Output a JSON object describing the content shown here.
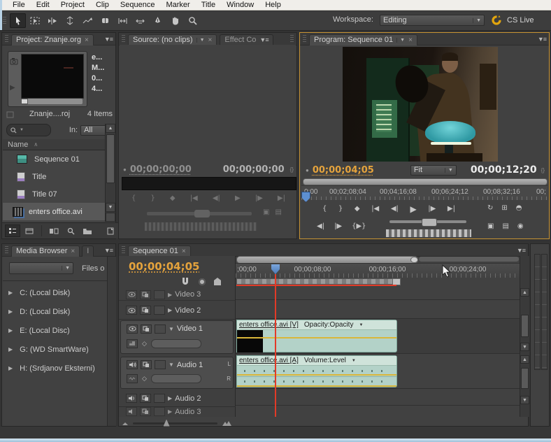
{
  "menu_bar": {
    "items": [
      "File",
      "Edit",
      "Project",
      "Clip",
      "Sequence",
      "Marker",
      "Title",
      "Window",
      "Help"
    ]
  },
  "toolbar": {
    "workspace_label": "Workspace:",
    "workspace_value": "Editing",
    "cs_live_label": "CS Live"
  },
  "icons": {
    "close": "×",
    "dropdown": "▼",
    "panel_menu": "▼≡",
    "collapsed": "▶",
    "expanded": "▼",
    "sort_asc": "∧",
    "scroll_up": "▲",
    "scroll_down": "▼",
    "scroll_left": "◀",
    "scroll_right": "▶",
    "trim_handles": "{}",
    "keyframe": "◇",
    "play": "▶"
  },
  "transport": {
    "row1": [
      "{",
      "}",
      "◆",
      "|◀",
      "◀|",
      "▶",
      "|▶",
      "▶|"
    ],
    "row1_right": [
      "↻",
      "⊞",
      "◓"
    ],
    "row2": [
      "◀|",
      "|▶",
      "{▶}"
    ],
    "row2_right": [
      "▣",
      "▤",
      "◉"
    ]
  },
  "project_panel": {
    "tab_label": "Project: Znanje.org",
    "preview_lines": [
      "e...",
      "M...",
      "0...",
      "4..."
    ],
    "name_truncated": "Znanje....roj",
    "items_count": "4 Items",
    "in_label": "In:",
    "in_value": "All",
    "name_column": "Name",
    "items": [
      {
        "label": "Sequence 01"
      },
      {
        "label": "Title"
      },
      {
        "label": "Title 07"
      },
      {
        "label": "enters office.avi"
      }
    ]
  },
  "source_panel": {
    "tab_label": "Source: (no clips)",
    "effects_tab_label": "Effect Co",
    "tc_left": "00;00;00;00",
    "tc_right": "00;00;00;00"
  },
  "program_panel": {
    "tab_label": "Program: Sequence 01",
    "tc_current": "00;00;04;05",
    "fit_label": "Fit",
    "tc_total": "00;00;12;20",
    "ruler_ticks": [
      "0;00",
      "00;02;08;04",
      "00;04;16;08",
      "00;06;24;12",
      "00;08;32;16",
      "00;"
    ]
  },
  "media_browser": {
    "tab_label": "Media Browser",
    "second_tab_label": "I",
    "files_label": "Files o",
    "drives": [
      "C: (Local Disk)",
      "D: (Local Disk)",
      "E: (Local Disc)",
      "G: (WD SmartWare)",
      "H: (Srdjanov Eksterni)"
    ]
  },
  "timeline": {
    "tab_label": "Sequence 01",
    "tc_current": "00;00;04;05",
    "ruler_ticks": [
      ";00;00",
      "00;00;08;00",
      "00;00;16;00",
      "00;00;24;00"
    ],
    "video_tracks": [
      "Video 3",
      "Video 2",
      "Video 1"
    ],
    "audio_tracks": [
      "Audio 1",
      "Audio 2",
      "Audio 3"
    ],
    "video_clip": {
      "label": "enters office.avi [V]",
      "effect": "Opacity:Opacity"
    },
    "audio_clip": {
      "label": "enters office.avi [A]",
      "effect": "Volume:Level"
    },
    "audio_channels": [
      "L",
      "R"
    ]
  },
  "colors": {
    "timecode_orange": "#e5a33c",
    "active_panel_border": "#c79333",
    "clip_fill": "#b3d2c8",
    "clip_header": "#cfe3da",
    "rubber_band_yellow": "#d9b63a",
    "cti_red": "#e23a28",
    "cti_blue": "#5d8fd0"
  }
}
